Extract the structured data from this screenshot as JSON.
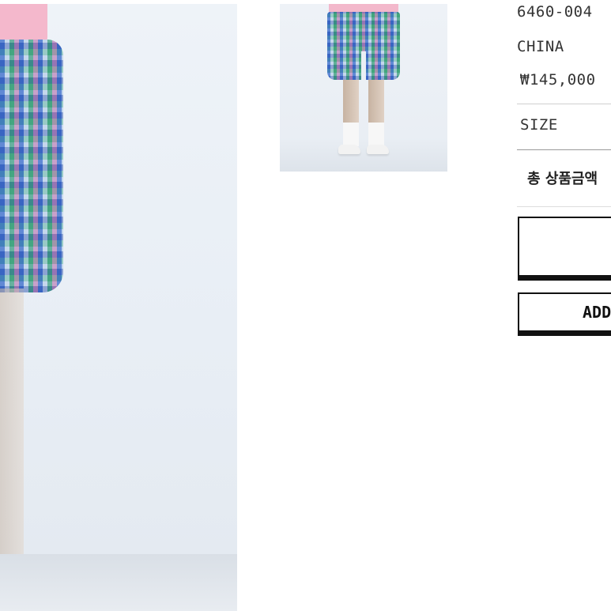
{
  "product": {
    "sku": "6460-004",
    "origin": "CHINA",
    "price": "₩145,000"
  },
  "options": {
    "size_label": "SIZE"
  },
  "summary": {
    "total_label": "총 상품금액"
  },
  "actions": {
    "buy_label": "",
    "cart_label": "ADD"
  },
  "icons": {
    "main_photo": "product-photo",
    "thumbnail": "product-thumbnail"
  }
}
